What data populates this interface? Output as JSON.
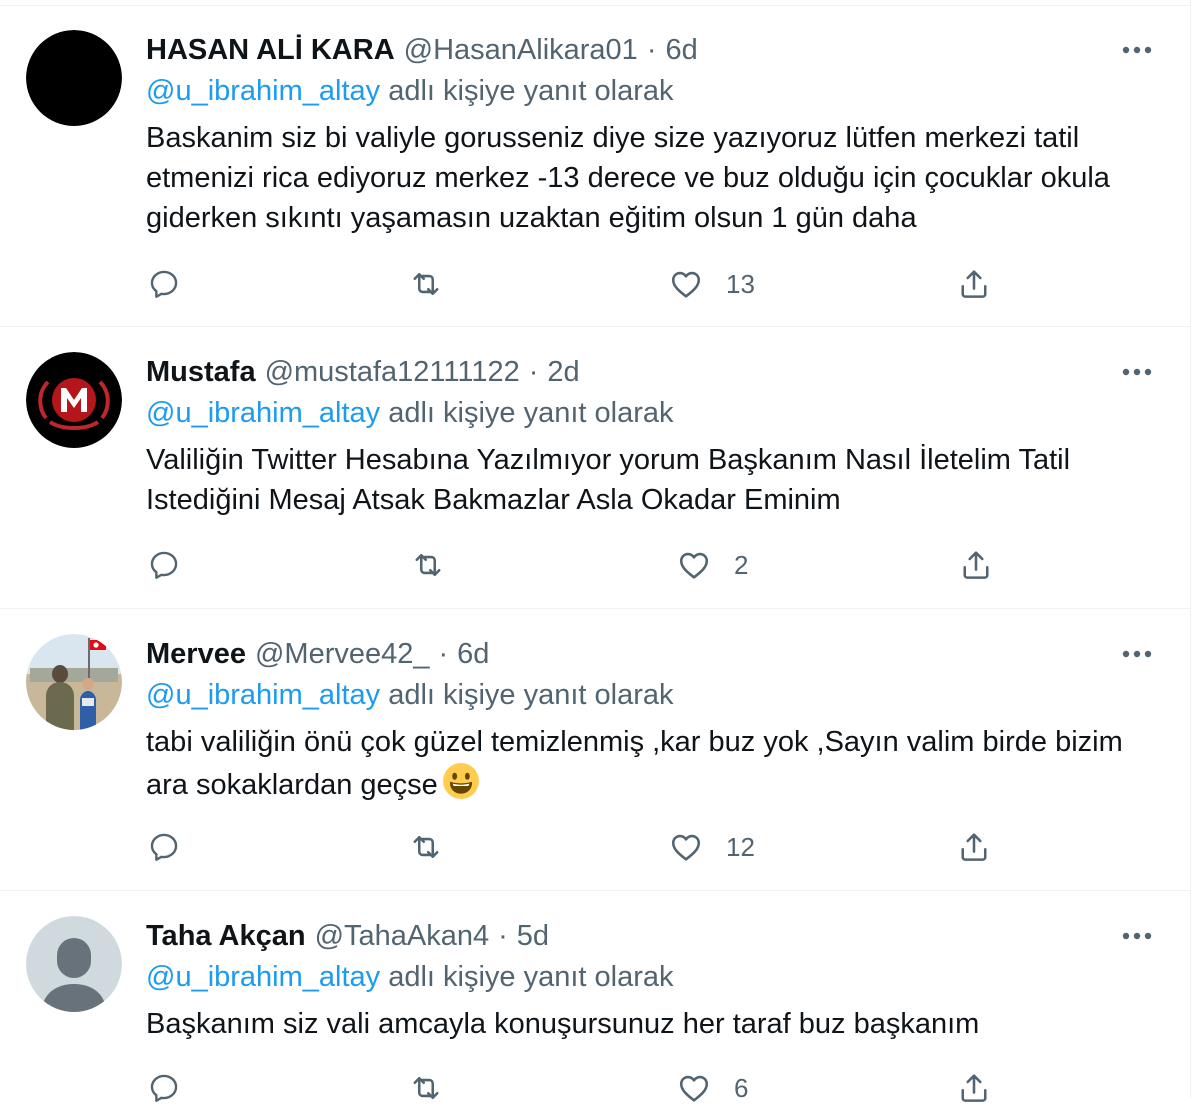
{
  "reply_prefix_text": "adlı kişiye yanıt olarak",
  "colors": {
    "link": "#1d9bf0",
    "secondary": "#536471",
    "primary_text": "#0f1419",
    "divider": "#eff3f4"
  },
  "tweets": [
    {
      "name": "HASAN ALİ KARA",
      "handle": "@HasanAlikara01",
      "separator": "·",
      "time": "6d",
      "reply_to": "@u_ibrahim_altay",
      "text": "Baskanim siz bi valiyle gorusseniz diye size yazıyoruz lütfen merkezi tatil etmenizi rica ediyoruz merkez -13 derece ve buz olduğu için çocuklar okula giderken sıkıntı yaşamasın uzaktan eğitim olsun 1 gün daha",
      "reply_count": "",
      "retweet_count": "",
      "like_count": "13",
      "avatar": "black-circle-avatar"
    },
    {
      "name": "Mustafa",
      "handle": "@mustafa12111122",
      "separator": "·",
      "time": "2d",
      "reply_to": "@u_ibrahim_altay",
      "text": "Valiliğin Twitter Hesabına Yazılmıyor yorum Başkanım Nasıl İletelim Tatil Istediğini Mesaj Atsak Bakmazlar Asla Okadar Eminim",
      "reply_count": "",
      "retweet_count": "",
      "like_count": "2",
      "avatar": "m-logo-avatar"
    },
    {
      "name": "Mervee",
      "handle": "@Mervee42_",
      "separator": "·",
      "time": "6d",
      "reply_to": "@u_ibrahim_altay",
      "text": "tabi valiliğin önü çok güzel temizlenmiş ,kar buz yok ,Sayın valim birde bizim ara sokaklardan geçse",
      "emoji": "grinning-face-emoji",
      "reply_count": "",
      "retweet_count": "",
      "like_count": "12",
      "avatar": "photo-avatar"
    },
    {
      "name": "Taha Akçan",
      "handle": "@TahaAkan4",
      "separator": "·",
      "time": "5d",
      "reply_to": "@u_ibrahim_altay",
      "text": "Başkanım siz vali amcayla konuşursunuz her taraf buz başkanım",
      "reply_count": "",
      "retweet_count": "",
      "like_count": "6",
      "avatar": "default-person-avatar"
    }
  ]
}
